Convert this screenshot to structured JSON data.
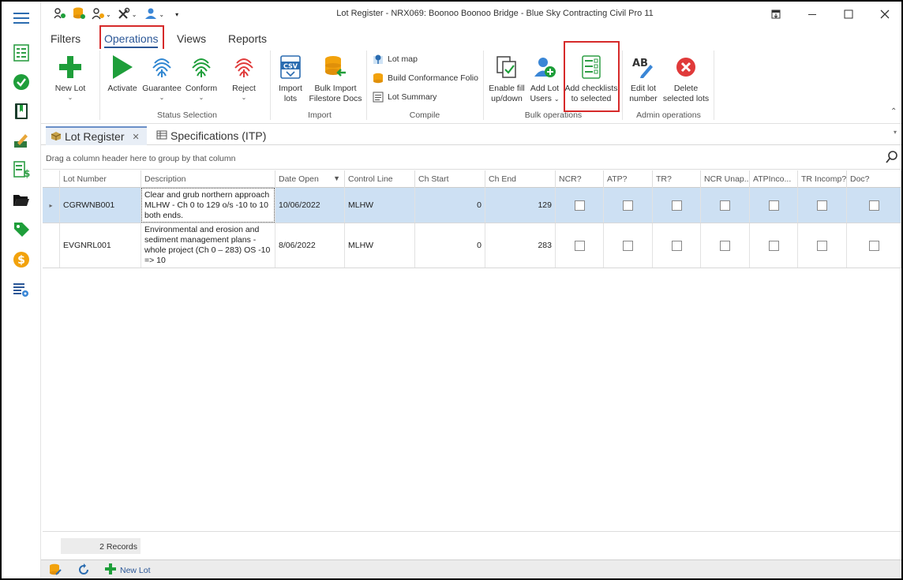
{
  "window": {
    "title": "Lot Register - NRX069: Boonoo Boonoo Bridge  - Blue Sky Contracting Civil Pro 11"
  },
  "ribbon_tabs": [
    "Filters",
    "Operations",
    "Views",
    "Reports"
  ],
  "ribbon": {
    "new_lot": "New Lot",
    "activate": "Activate",
    "guarantee": "Guarantee",
    "conform": "Conform",
    "reject": "Reject",
    "status_group": "Status Selection",
    "import_lots_1": "Import",
    "import_lots_2": "lots",
    "bulk_import_1": "Bulk Import",
    "bulk_import_2": "Filestore Docs",
    "import_group": "Import",
    "lot_map": "Lot map",
    "build_folio": "Build Conformance Folio",
    "lot_summary": "Lot Summary",
    "compile_group": "Compile",
    "enable_fill_1": "Enable fill",
    "enable_fill_2": "up/down",
    "add_lot_users_1": "Add Lot",
    "add_lot_users_2": "Users",
    "add_checklists_1": "Add checklists",
    "add_checklists_2": "to selected",
    "bulk_group": "Bulk operations",
    "edit_lot_1": "Edit lot",
    "edit_lot_2": "number",
    "delete_lots_1": "Delete",
    "delete_lots_2": "selected lots",
    "admin_group": "Admin operations"
  },
  "doc_tabs": {
    "lot_register": "Lot Register",
    "specifications": "Specifications (ITP)"
  },
  "grid": {
    "group_hint": "Drag a column header here to group by that column",
    "columns": [
      "Lot Number",
      "Description",
      "Date Open",
      "Control Line",
      "Ch Start",
      "Ch End",
      "NCR?",
      "ATP?",
      "TR?",
      "NCR Unap...",
      "ATPInco...",
      "TR Incomp?",
      "Doc?"
    ],
    "rows": [
      {
        "lot_number": "CGRWNB001",
        "description": "Clear and grub northern approach MLHW - Ch 0 to 129  o/s -10 to 10 both ends.",
        "date_open": "10/06/2022",
        "control_line": "MLHW",
        "ch_start": "0",
        "ch_end": "129"
      },
      {
        "lot_number": "EVGNRL001",
        "description": "Environmental and erosion and sediment management plans - whole project (Ch 0 – 283) OS -10 => 10",
        "date_open": "8/06/2022",
        "control_line": "MLHW",
        "ch_start": "0",
        "ch_end": "283"
      }
    ],
    "record_count": "2 Records"
  },
  "statusbar": {
    "new_lot": "New Lot"
  },
  "colors": {
    "accent": "#2b5797",
    "highlight_box": "#d62a2a",
    "selected_row": "#cde0f3",
    "green": "#1e9e3a"
  }
}
